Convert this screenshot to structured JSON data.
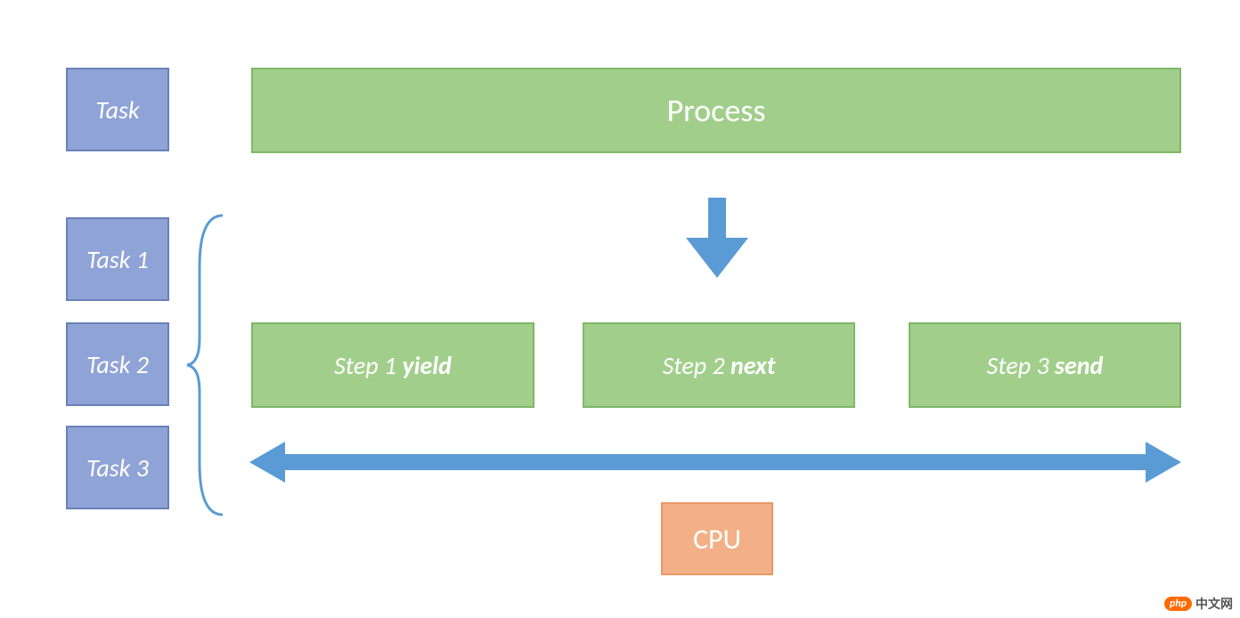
{
  "top": {
    "task_label": "Task",
    "process_label": "Process"
  },
  "tasks": {
    "t1": "Task 1",
    "t2": "Task 2",
    "t3": "Task 3"
  },
  "steps": {
    "s1_prefix": "Step 1 ",
    "s1_bold": "yield",
    "s2_prefix": "Step 2 ",
    "s2_bold": "next",
    "s3_prefix": "Step 3 ",
    "s3_bold": "send"
  },
  "cpu_label": "CPU",
  "watermark": {
    "badge": "php",
    "text": "中文网"
  },
  "colors": {
    "blue_fill": "#8fa3d6",
    "blue_border": "#6981b8",
    "green_fill": "#a1cf8b",
    "green_border": "#7fb767",
    "orange_fill": "#f3b087",
    "orange_border": "#e89863",
    "arrow": "#5a9bd5"
  }
}
